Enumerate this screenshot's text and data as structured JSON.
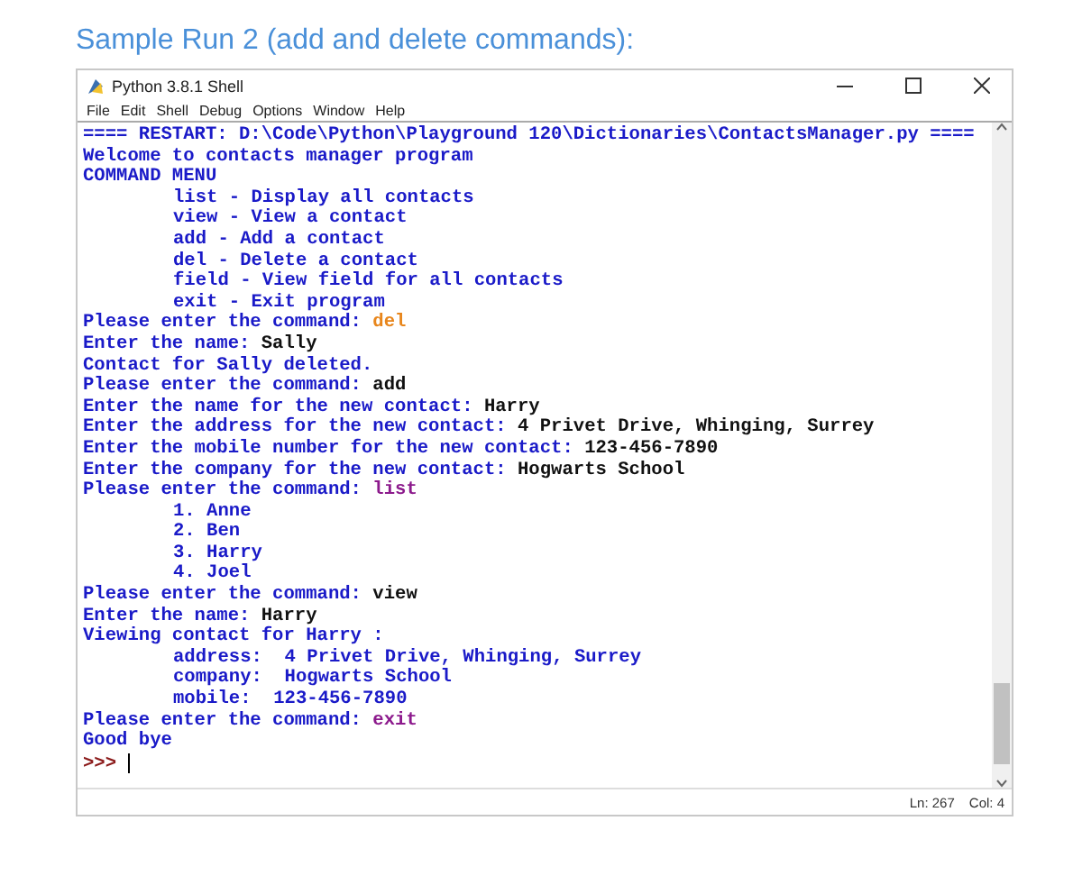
{
  "heading": "Sample Run 2 (add and delete commands):",
  "window": {
    "title": "Python 3.8.1 Shell"
  },
  "menu": [
    "File",
    "Edit",
    "Shell",
    "Debug",
    "Options",
    "Window",
    "Help"
  ],
  "shell_lines": [
    {
      "indented": false,
      "parts": [
        {
          "kind": "output",
          "text": "==== RESTART: D:\\Code\\Python\\Playground 120\\Dictionaries\\ContactsManager.py ===="
        }
      ]
    },
    {
      "indented": false,
      "parts": [
        {
          "kind": "output",
          "text": "Welcome to contacts manager program"
        }
      ]
    },
    {
      "indented": false,
      "parts": [
        {
          "kind": "output",
          "text": "COMMAND MENU"
        }
      ]
    },
    {
      "indented": true,
      "parts": [
        {
          "kind": "output",
          "text": "list - Display all contacts"
        }
      ]
    },
    {
      "indented": true,
      "parts": [
        {
          "kind": "output",
          "text": "view - View a contact"
        }
      ]
    },
    {
      "indented": true,
      "parts": [
        {
          "kind": "output",
          "text": "add - Add a contact"
        }
      ]
    },
    {
      "indented": true,
      "parts": [
        {
          "kind": "output",
          "text": "del - Delete a contact"
        }
      ]
    },
    {
      "indented": true,
      "parts": [
        {
          "kind": "output",
          "text": "field - View field for all contacts"
        }
      ]
    },
    {
      "indented": true,
      "parts": [
        {
          "kind": "output",
          "text": "exit - Exit program"
        }
      ]
    },
    {
      "indented": false,
      "parts": [
        {
          "kind": "output",
          "text": "Please enter the command: "
        },
        {
          "kind": "keyword",
          "text": "del"
        }
      ]
    },
    {
      "indented": false,
      "parts": [
        {
          "kind": "output",
          "text": "Enter the name: "
        },
        {
          "kind": "input",
          "text": "Sally"
        }
      ]
    },
    {
      "indented": false,
      "parts": [
        {
          "kind": "output",
          "text": "Contact for Sally deleted."
        }
      ]
    },
    {
      "indented": false,
      "parts": [
        {
          "kind": "output",
          "text": "Please enter the command: "
        },
        {
          "kind": "input",
          "text": "add"
        }
      ]
    },
    {
      "indented": false,
      "parts": [
        {
          "kind": "output",
          "text": "Enter the name for the new contact: "
        },
        {
          "kind": "input",
          "text": "Harry"
        }
      ]
    },
    {
      "indented": false,
      "parts": [
        {
          "kind": "output",
          "text": "Enter the address for the new contact: "
        },
        {
          "kind": "input",
          "text": "4 Privet Drive, Whinging, Surrey"
        }
      ]
    },
    {
      "indented": false,
      "parts": [
        {
          "kind": "output",
          "text": "Enter the mobile number for the new contact: "
        },
        {
          "kind": "input",
          "text": "123-456-7890"
        }
      ]
    },
    {
      "indented": false,
      "parts": [
        {
          "kind": "output",
          "text": "Enter the company for the new contact: "
        },
        {
          "kind": "input",
          "text": "Hogwarts School"
        }
      ]
    },
    {
      "indented": false,
      "parts": [
        {
          "kind": "output",
          "text": "Please enter the command: "
        },
        {
          "kind": "builtin",
          "text": "list"
        }
      ]
    },
    {
      "indented": true,
      "parts": [
        {
          "kind": "output",
          "text": "1. Anne"
        }
      ]
    },
    {
      "indented": true,
      "parts": [
        {
          "kind": "output",
          "text": "2. Ben"
        }
      ]
    },
    {
      "indented": true,
      "parts": [
        {
          "kind": "output",
          "text": "3. Harry"
        }
      ]
    },
    {
      "indented": true,
      "parts": [
        {
          "kind": "output",
          "text": "4. Joel"
        }
      ]
    },
    {
      "indented": false,
      "parts": [
        {
          "kind": "output",
          "text": "Please enter the command: "
        },
        {
          "kind": "input",
          "text": "view"
        }
      ]
    },
    {
      "indented": false,
      "parts": [
        {
          "kind": "output",
          "text": "Enter the name: "
        },
        {
          "kind": "input",
          "text": "Harry"
        }
      ]
    },
    {
      "indented": false,
      "parts": [
        {
          "kind": "output",
          "text": "Viewing contact for Harry :"
        }
      ]
    },
    {
      "indented": true,
      "parts": [
        {
          "kind": "output",
          "text": "address:  4 Privet Drive, Whinging, Surrey"
        }
      ]
    },
    {
      "indented": true,
      "parts": [
        {
          "kind": "output",
          "text": "company:  Hogwarts School"
        }
      ]
    },
    {
      "indented": true,
      "parts": [
        {
          "kind": "output",
          "text": "mobile:  123-456-7890"
        }
      ]
    },
    {
      "indented": false,
      "parts": [
        {
          "kind": "output",
          "text": "Please enter the command: "
        },
        {
          "kind": "builtin",
          "text": "exit"
        }
      ]
    },
    {
      "indented": false,
      "parts": [
        {
          "kind": "output",
          "text": "Good bye"
        }
      ]
    }
  ],
  "prompt": ">>>",
  "status_bar": {
    "line": "Ln: 267",
    "column": "Col: 4"
  }
}
